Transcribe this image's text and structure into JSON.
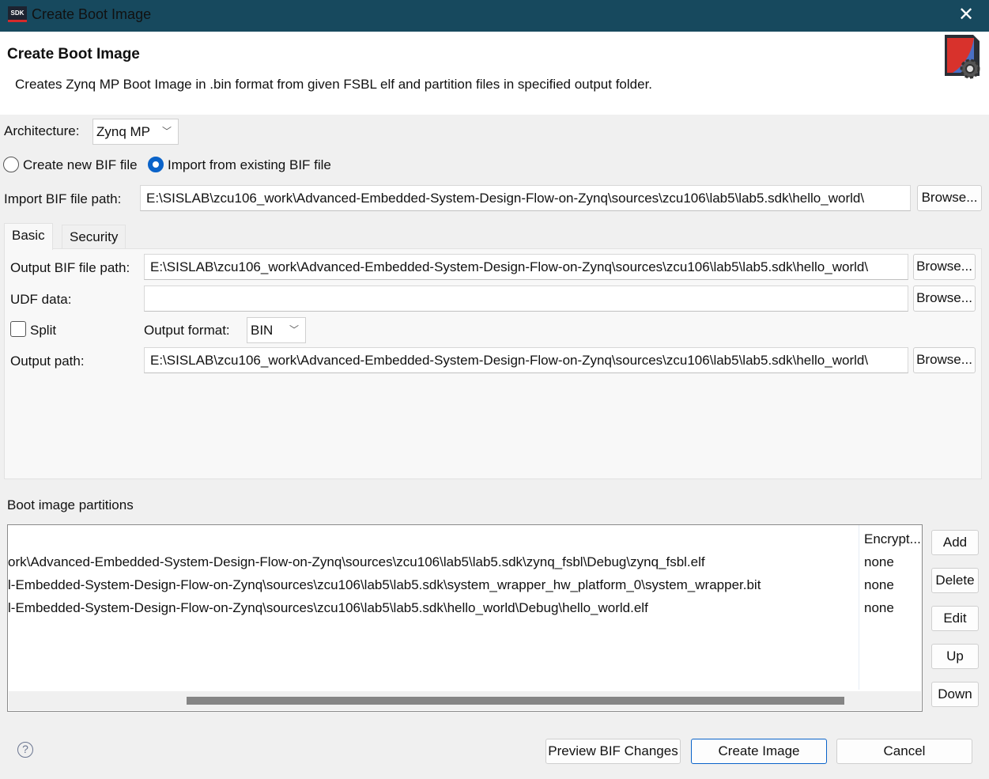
{
  "window": {
    "title": "Create Boot Image",
    "app_badge": "SDK"
  },
  "header": {
    "title": "Create Boot Image",
    "description": "Creates Zynq MP Boot Image in .bin format from given FSBL elf and partition files in specified output folder."
  },
  "architecture": {
    "label": "Architecture:",
    "value": "Zynq MP"
  },
  "mode": {
    "create_new_label": "Create new BIF file",
    "import_label": "Import from existing BIF file",
    "selected": "import"
  },
  "import_bif": {
    "label": "Import BIF file path:",
    "value": "E:\\SISLAB\\zcu106_work\\Advanced-Embedded-System-Design-Flow-on-Zynq\\sources\\zcu106\\lab5\\lab5.sdk\\hello_world\\",
    "browse": "Browse..."
  },
  "tabs": [
    {
      "label": "Basic",
      "active": true
    },
    {
      "label": "Security",
      "active": false
    }
  ],
  "basic": {
    "output_bif": {
      "label": "Output BIF file path:",
      "value": "E:\\SISLAB\\zcu106_work\\Advanced-Embedded-System-Design-Flow-on-Zynq\\sources\\zcu106\\lab5\\lab5.sdk\\hello_world\\",
      "browse": "Browse..."
    },
    "udf": {
      "label": "UDF data:",
      "value": "",
      "browse": "Browse..."
    },
    "split": {
      "label": "Split",
      "checked": false
    },
    "output_format": {
      "label": "Output format:",
      "value": "BIN"
    },
    "output_path": {
      "label": "Output path:",
      "value": "E:\\SISLAB\\zcu106_work\\Advanced-Embedded-System-Design-Flow-on-Zynq\\sources\\zcu106\\lab5\\lab5.sdk\\hello_world\\",
      "browse": "Browse..."
    }
  },
  "partitions": {
    "label": "Boot image partitions",
    "columns": [
      "",
      "Encrypt..."
    ],
    "rows": [
      {
        "file": "ork\\Advanced-Embedded-System-Design-Flow-on-Zynq\\sources\\zcu106\\lab5\\lab5.sdk\\zynq_fsbl\\Debug\\zynq_fsbl.elf",
        "encryption": "none"
      },
      {
        "file": "l-Embedded-System-Design-Flow-on-Zynq\\sources\\zcu106\\lab5\\lab5.sdk\\system_wrapper_hw_platform_0\\system_wrapper.bit",
        "encryption": "none"
      },
      {
        "file": "l-Embedded-System-Design-Flow-on-Zynq\\sources\\zcu106\\lab5\\lab5.sdk\\hello_world\\Debug\\hello_world.elf",
        "encryption": "none"
      }
    ],
    "buttons": {
      "add": "Add",
      "delete": "Delete",
      "edit": "Edit",
      "up": "Up",
      "down": "Down"
    }
  },
  "footer": {
    "preview": "Preview BIF Changes",
    "create": "Create Image",
    "cancel": "Cancel"
  },
  "colors": {
    "titlebar": "#17495e",
    "accent": "#0a63c9"
  }
}
